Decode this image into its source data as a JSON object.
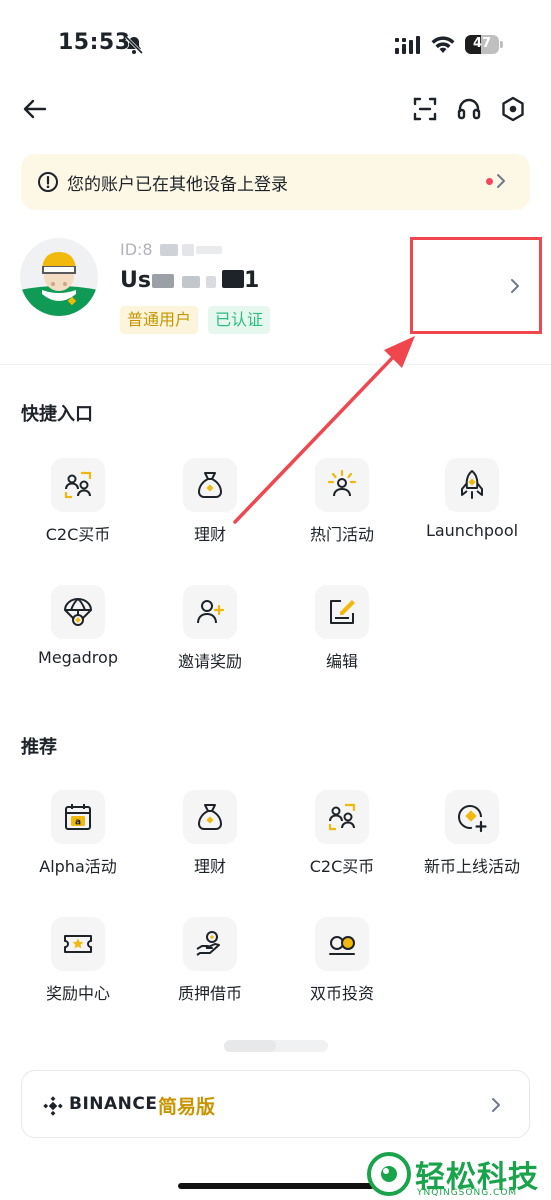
{
  "status_bar": {
    "time": "15:53",
    "battery": "47"
  },
  "notice": {
    "text": "您的账户已在其他设备上登录"
  },
  "profile": {
    "id_prefix": "ID:8",
    "name_prefix": "Us",
    "name_suffix": "1",
    "tags": [
      "普通用户",
      "已认证"
    ]
  },
  "shortcuts": {
    "title": "快捷入口",
    "items": [
      {
        "label": "C2C买币",
        "icon": "c2c-people-icon"
      },
      {
        "label": "理财",
        "icon": "money-bag-icon"
      },
      {
        "label": "热门活动",
        "icon": "spotlight-person-icon"
      },
      {
        "label": "Launchpool",
        "icon": "rocket-icon"
      },
      {
        "label": "Megadrop",
        "icon": "parachute-icon"
      },
      {
        "label": "邀请奖励",
        "icon": "add-person-icon"
      },
      {
        "label": "编辑",
        "icon": "edit-icon"
      }
    ]
  },
  "recommend": {
    "title": "推荐",
    "items": [
      {
        "label": "Alpha活动",
        "icon": "calendar-icon"
      },
      {
        "label": "理财",
        "icon": "money-bag-icon"
      },
      {
        "label": "C2C买币",
        "icon": "c2c-people-icon"
      },
      {
        "label": "新币上线活动",
        "icon": "new-coin-icon"
      },
      {
        "label": "奖励中心",
        "icon": "ticket-star-icon"
      },
      {
        "label": "质押借币",
        "icon": "hand-coin-icon"
      },
      {
        "label": "双币投资",
        "icon": "dual-coin-icon"
      }
    ]
  },
  "lite": {
    "brand": "BINANCE",
    "name": "简易版"
  },
  "watermark": {
    "text": "轻松科技",
    "sub": "YNQINGSONG.COM"
  },
  "colors": {
    "accent": "#F0B90B",
    "brand_gold": "#C99400",
    "verified_green": "#2EBD85",
    "annotation_red": "#F0464E"
  }
}
